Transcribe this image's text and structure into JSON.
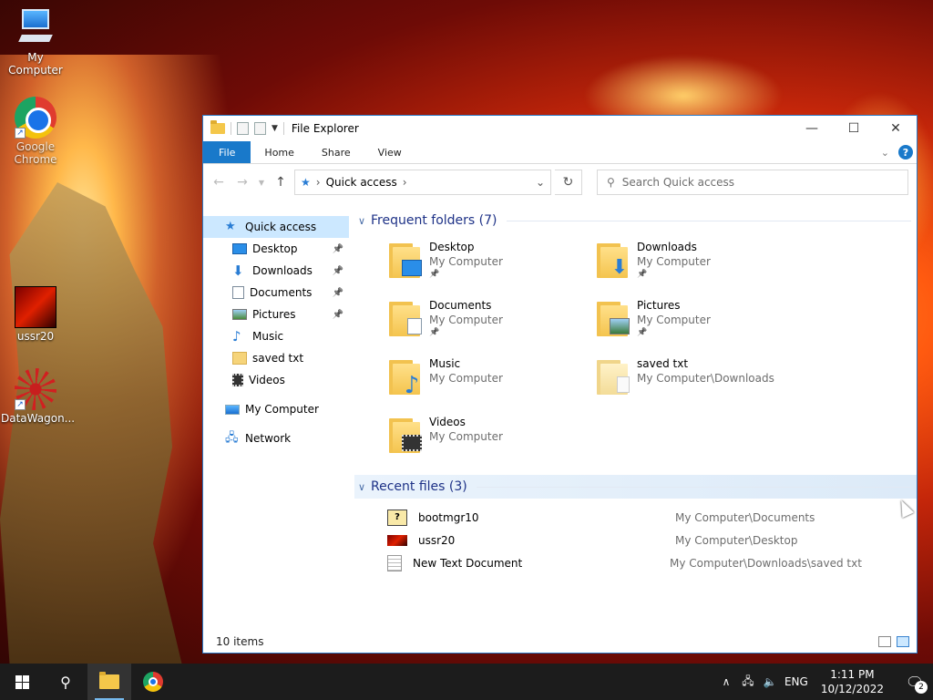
{
  "desktop": {
    "icons": [
      {
        "label": "My Computer"
      },
      {
        "label": "Google Chrome"
      },
      {
        "label": "ussr20"
      },
      {
        "label": "DataWagon..."
      }
    ]
  },
  "window": {
    "title": "File Explorer",
    "controls": {
      "minimize": "—",
      "maximize": "☐",
      "close": "✕"
    },
    "ribbon": {
      "tabs": [
        "File",
        "Home",
        "Share",
        "View"
      ],
      "help": "?"
    },
    "address": {
      "location": "Quick access",
      "separator": "›",
      "dropdown": "⌄",
      "refresh": "↻"
    },
    "search": {
      "placeholder": "Search Quick access"
    },
    "nav": {
      "quick_access": "Quick access",
      "pinned": [
        "Desktop",
        "Downloads",
        "Documents",
        "Pictures"
      ],
      "other": [
        "Music",
        "saved txt",
        "Videos"
      ],
      "my_computer": "My Computer",
      "network": "Network",
      "pin_glyph": "📌"
    },
    "frequent": {
      "header": "Frequent folders (7)",
      "items": [
        {
          "name": "Desktop",
          "path": "My Computer",
          "pinned": true
        },
        {
          "name": "Downloads",
          "path": "My Computer",
          "pinned": true
        },
        {
          "name": "Documents",
          "path": "My Computer",
          "pinned": true
        },
        {
          "name": "Pictures",
          "path": "My Computer",
          "pinned": true
        },
        {
          "name": "Music",
          "path": "My Computer",
          "pinned": false
        },
        {
          "name": "saved txt",
          "path": "My Computer\\Downloads",
          "pinned": false
        },
        {
          "name": "Videos",
          "path": "My Computer",
          "pinned": false
        }
      ]
    },
    "recent": {
      "header": "Recent files (3)",
      "items": [
        {
          "name": "bootmgr10",
          "path": "My Computer\\Documents"
        },
        {
          "name": "ussr20",
          "path": "My Computer\\Desktop"
        },
        {
          "name": "New Text Document",
          "path": "My Computer\\Downloads\\saved txt"
        }
      ]
    },
    "status": "10 items"
  },
  "taskbar": {
    "tray": {
      "language": "ENG",
      "time": "1:11 PM",
      "date": "10/12/2022",
      "notifications": "2"
    }
  },
  "colors": {
    "accent": "#1979ca",
    "selection": "#cce8ff",
    "group_header": "#1e3287",
    "taskbar": "#1c1c1c"
  }
}
